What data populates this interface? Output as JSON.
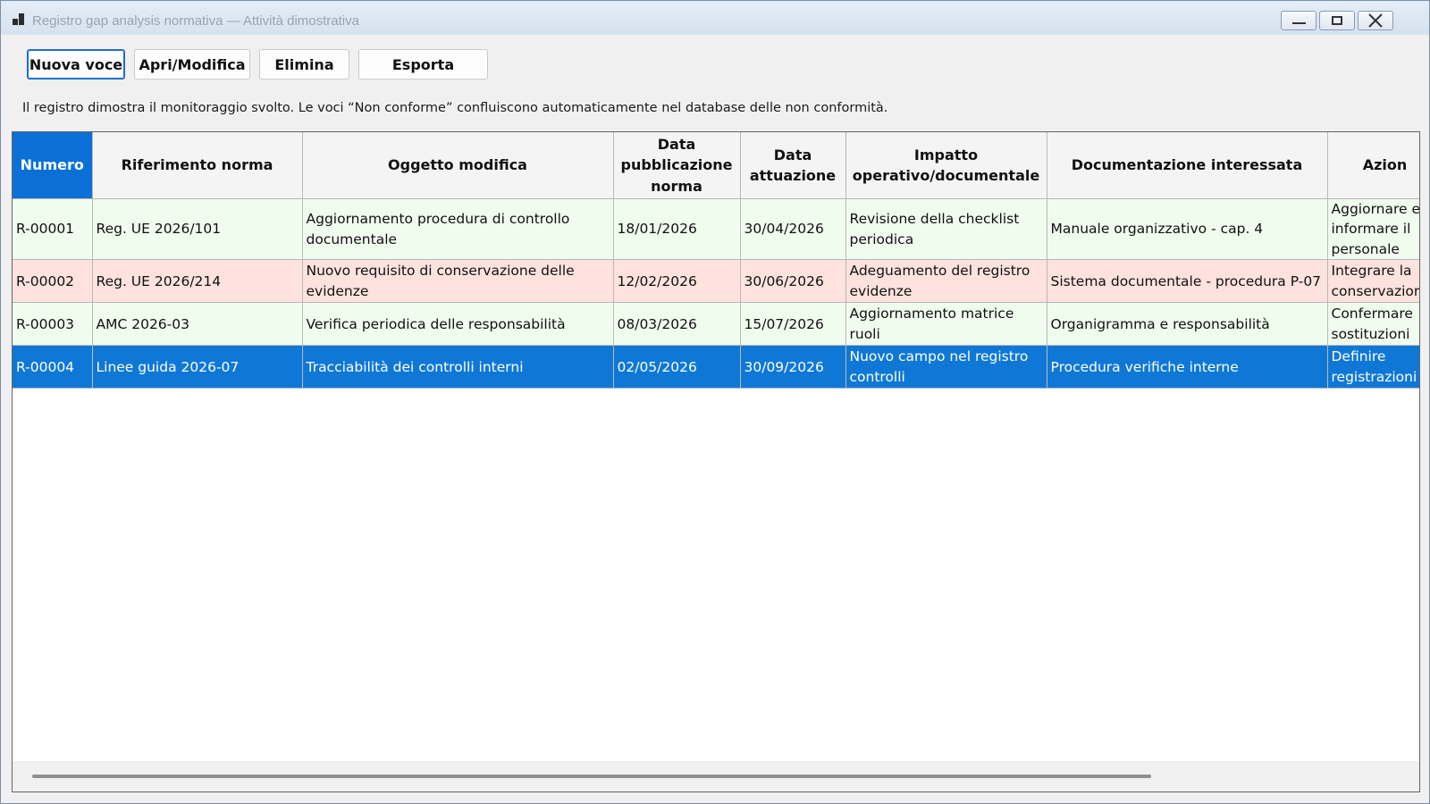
{
  "window": {
    "title": "Registro gap analysis normativa — Attività dimostrativa"
  },
  "toolbar": {
    "new_label": "Nuova voce",
    "open_label": "Apri/Modifica",
    "delete_label": "Elimina",
    "export_label": "Esporta"
  },
  "info": "Il registro dimostra il monitoraggio svolto. Le voci “Non conforme” confluiscono automaticamente nel database delle non conformità.",
  "table": {
    "columns": [
      "Numero",
      "Riferimento norma",
      "Oggetto modifica",
      "Data pubblicazione norma",
      "Data attuazione",
      "Impatto operativo/documentale",
      "Documentazione interessata",
      "Azion"
    ],
    "rows": [
      {
        "status": "ok",
        "cells": [
          "R-00001",
          "Reg. UE 2026/101",
          "Aggiornamento procedura di controllo documentale",
          "18/01/2026",
          "30/04/2026",
          "Revisione della checklist periodica",
          "Manuale organizzativo - cap. 4",
          "Aggiornare e informare il personale"
        ]
      },
      {
        "status": "nc",
        "cells": [
          "R-00002",
          "Reg. UE 2026/214",
          "Nuovo requisito di conservazione delle evidenze",
          "12/02/2026",
          "30/06/2026",
          "Adeguamento del registro evidenze",
          "Sistema documentale - procedura P-07",
          "Integrare la conservazione"
        ]
      },
      {
        "status": "ok",
        "cells": [
          "R-00003",
          "AMC 2026-03",
          "Verifica periodica delle responsabilità",
          "08/03/2026",
          "15/07/2026",
          "Aggiornamento matrice ruoli",
          "Organigramma e responsabilità",
          "Confermare sostituzioni"
        ]
      },
      {
        "status": "sel",
        "cells": [
          "R-00004",
          "Linee guida 2026-07",
          "Tracciabilità dei controlli interni",
          "02/05/2026",
          "30/09/2026",
          "Nuovo campo nel registro controlli",
          "Procedura verifiche interne",
          "Definire registrazioni"
        ]
      }
    ]
  },
  "colors": {
    "header_active": "#0a70d8",
    "row_ok": "#f0fcee",
    "row_nc": "#fde2de",
    "row_selected": "#0f78d7"
  },
  "icons": [
    "app-icon",
    "minimize-icon",
    "maximize-icon",
    "close-icon"
  ]
}
